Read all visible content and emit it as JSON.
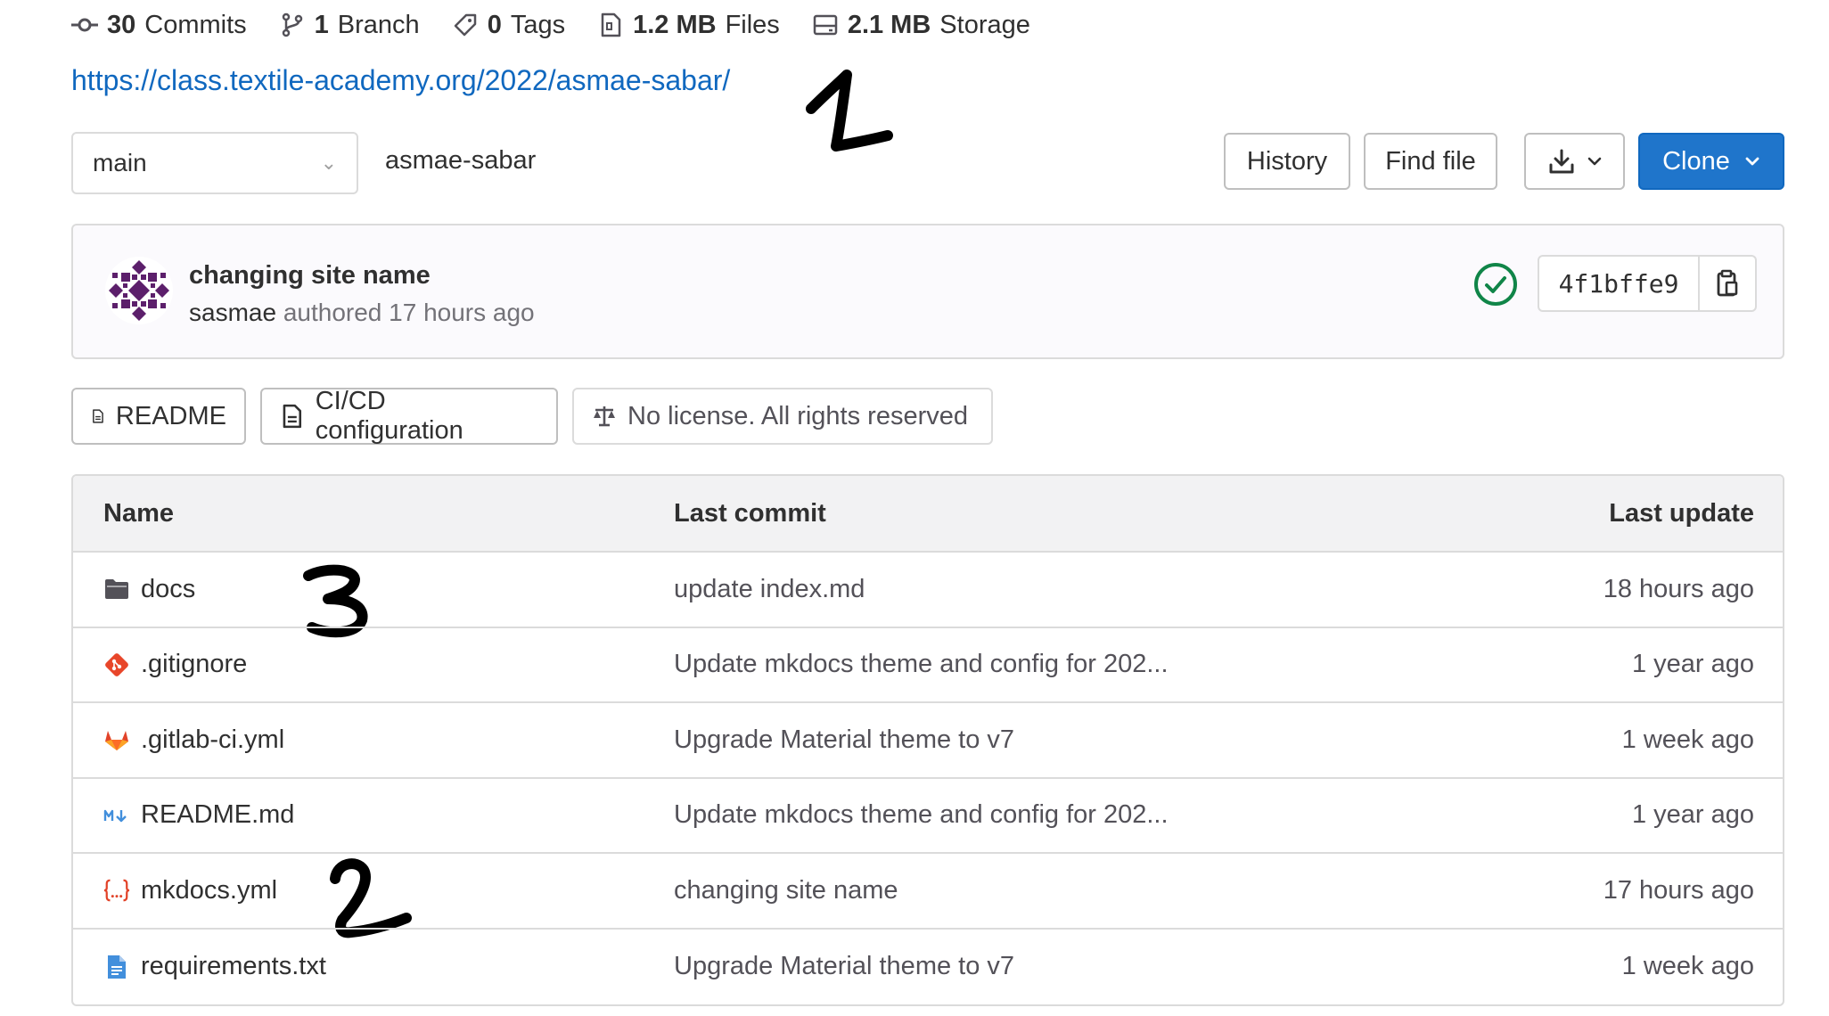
{
  "stats": [
    {
      "icon": "commit-icon",
      "value": "30",
      "label": "Commits"
    },
    {
      "icon": "branch-icon",
      "value": "1",
      "label": "Branch"
    },
    {
      "icon": "tag-icon",
      "value": "0",
      "label": "Tags"
    },
    {
      "icon": "file-zip-icon",
      "value": "1.2 MB",
      "label": "Files"
    },
    {
      "icon": "storage-icon",
      "value": "2.1 MB",
      "label": "Storage"
    }
  ],
  "project_url": "https://class.textile-academy.org/2022/asmae-sabar/",
  "toolbar": {
    "branch": "main",
    "path": "asmae-sabar",
    "history_label": "History",
    "find_file_label": "Find file",
    "clone_label": "Clone"
  },
  "last_commit": {
    "title": "changing site name",
    "author": "sasmae",
    "authored_text": "authored 17 hours ago",
    "sha": "4f1bffe9",
    "pipeline_status": "passed"
  },
  "quick_links": [
    {
      "icon": "doc-icon",
      "label": "README"
    },
    {
      "icon": "doc-icon",
      "label": "CI/CD configuration"
    },
    {
      "icon": "scale-icon",
      "label": "No license. All rights reserved"
    }
  ],
  "table": {
    "headers": {
      "name": "Name",
      "last_commit": "Last commit",
      "last_update": "Last update"
    },
    "rows": [
      {
        "icon": "folder-icon",
        "name": "docs",
        "commit": "update index.md",
        "updated": "18 hours ago"
      },
      {
        "icon": "git-icon",
        "name": ".gitignore",
        "commit": "Update mkdocs theme and config for 202...",
        "updated": "1 year ago"
      },
      {
        "icon": "gitlab-icon",
        "name": ".gitlab-ci.yml",
        "commit": "Upgrade Material theme to v7",
        "updated": "1 week ago"
      },
      {
        "icon": "markdown-icon",
        "name": "README.md",
        "commit": "Update mkdocs theme and config for 202...",
        "updated": "1 year ago"
      },
      {
        "icon": "yaml-icon",
        "name": "mkdocs.yml",
        "commit": "changing site name",
        "updated": "17 hours ago"
      },
      {
        "icon": "text-file-icon",
        "name": "requirements.txt",
        "commit": "Upgrade Material theme to v7",
        "updated": "1 week ago"
      }
    ]
  },
  "annotations": [
    "1",
    "2",
    "3"
  ],
  "colors": {
    "link": "#1068bf",
    "clone_button": "#1f75cb",
    "success": "#108548"
  }
}
